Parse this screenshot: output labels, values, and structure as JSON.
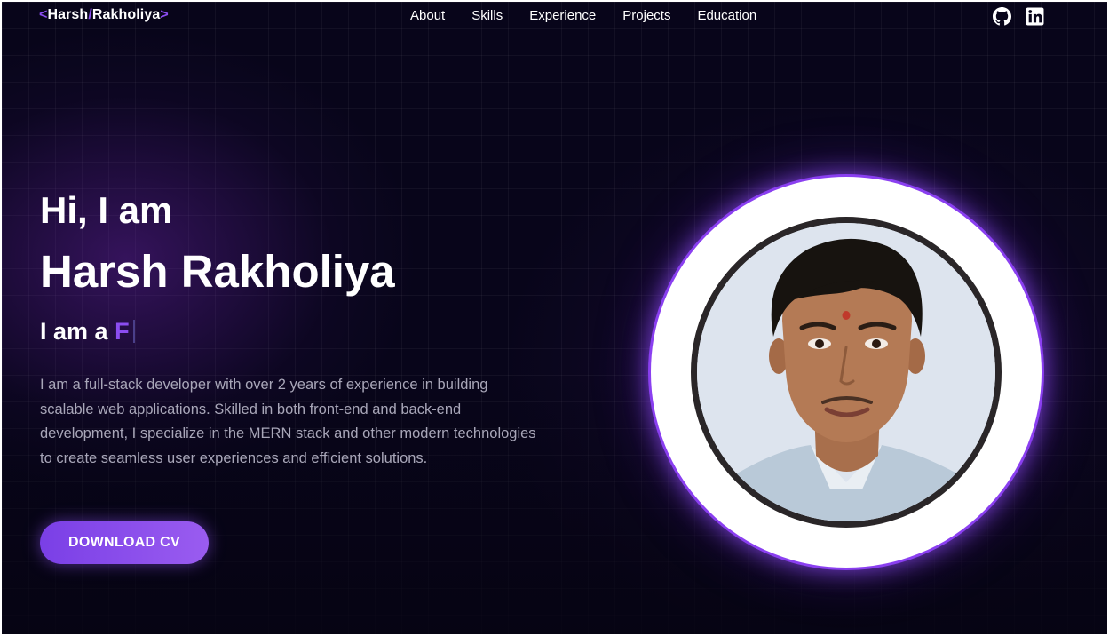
{
  "logo": {
    "open": "<",
    "first": "Harsh",
    "slash": "/",
    "last": "Rakholiya",
    "close": ">"
  },
  "nav": {
    "links": [
      "About",
      "Skills",
      "Experience",
      "Projects",
      "Education"
    ],
    "icons": [
      "github-icon",
      "linkedin-icon"
    ]
  },
  "hero": {
    "greeting": "Hi, I am",
    "name": "Harsh Rakholiya",
    "role_prefix": "I am a",
    "role_typed": "F",
    "bio": "I am a full-stack developer with over 2 years of experience in building scalable web applications. Skilled in both front-end and back-end development, I specialize in the MERN stack and other modern technologies to create seamless user experiences and efficient solutions.",
    "cta_label": "DOWNLOAD CV"
  },
  "colors": {
    "accent": "#8b4df0",
    "background": "#08051a",
    "text": "#ffffff",
    "muted": "#a8a6b8"
  }
}
